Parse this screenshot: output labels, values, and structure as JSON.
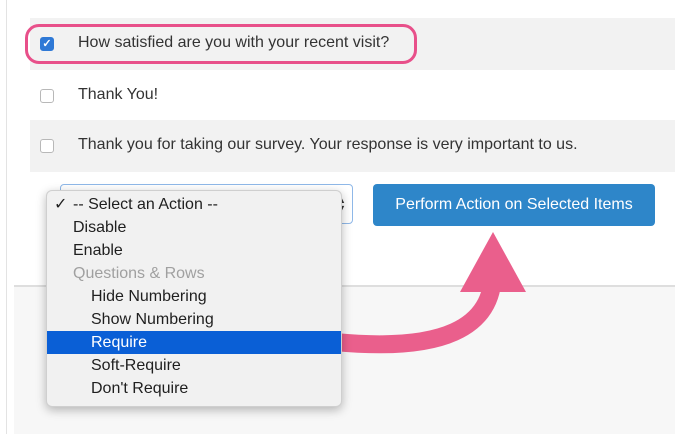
{
  "rows": [
    {
      "text": "How satisfied are you with your recent visit?",
      "checked": true
    },
    {
      "text": "Thank You!",
      "checked": false
    },
    {
      "text": "Thank you for taking our survey. Your response is very important to us.",
      "checked": false
    }
  ],
  "action_select": {
    "selected": "-- Select an Action --",
    "options": [
      {
        "label": "-- Select an Action --",
        "kind": "current"
      },
      {
        "label": "Disable",
        "kind": "option"
      },
      {
        "label": "Enable",
        "kind": "option"
      },
      {
        "label": "Questions & Rows",
        "kind": "group"
      },
      {
        "label": "Hide Numbering",
        "kind": "sub-option"
      },
      {
        "label": "Show Numbering",
        "kind": "sub-option"
      },
      {
        "label": "Require",
        "kind": "sub-option-highlighted"
      },
      {
        "label": "Soft-Require",
        "kind": "sub-option"
      },
      {
        "label": "Don't Require",
        "kind": "sub-option"
      }
    ]
  },
  "perform_button": {
    "label": "Perform Action on Selected Items"
  },
  "checkmark_glyph": "✓",
  "colors": {
    "highlight_pill": "#e8508a",
    "arrow": "#ea5f8c",
    "button": "#2e86c9",
    "menu_selection": "#0a5fd6",
    "checkbox_checked": "#2f79d6"
  },
  "icons": {
    "select_arrows": "up-down-chevron-icon",
    "checkmark": "checkmark-icon",
    "annotation": "curved-arrow-icon"
  }
}
